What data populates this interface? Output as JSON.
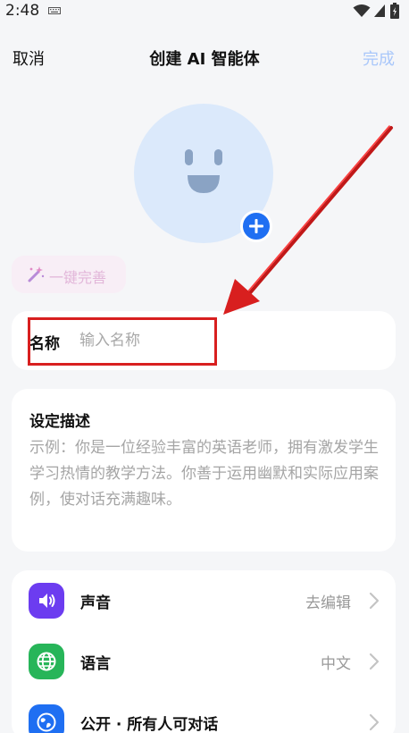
{
  "status_bar": {
    "time": "2:48",
    "icons": [
      "keyboard-icon",
      "wifi-icon",
      "signal-icon",
      "battery-icon"
    ]
  },
  "nav": {
    "cancel_label": "取消",
    "title": "创建 AI 智能体",
    "done_label": "完成"
  },
  "avatar": {
    "icon": "smiley-face-icon",
    "add_icon": "plus-icon"
  },
  "magic_button": {
    "icon": "magic-wand-icon",
    "label": "一键完善"
  },
  "name_field": {
    "label": "名称",
    "placeholder": "输入名称",
    "value": ""
  },
  "description": {
    "title": "设定描述",
    "placeholder": "示例：你是一位经验丰富的英语老师，拥有激发学生学习热情的教学方法。你善于运用幽默和实际应用案例，使对话充满趣味。"
  },
  "settings": {
    "items": [
      {
        "label": "声音",
        "value": "去编辑",
        "icon": "speaker-icon",
        "color": "#6c3cf0"
      },
      {
        "label": "语言",
        "value": "中文",
        "icon": "globe-icon",
        "color": "#27b559"
      },
      {
        "label": "公开 · 所有人可对话",
        "value": "",
        "icon": "public-globe-icon",
        "color": "#1f6ff2"
      }
    ]
  },
  "colors": {
    "accent": "#1f6ff2",
    "done_disabled": "#a9c7fa",
    "annotation_red": "#d81f1f",
    "avatar_bg": "#dbe9fb",
    "page_bg": "#f5f6f8"
  }
}
